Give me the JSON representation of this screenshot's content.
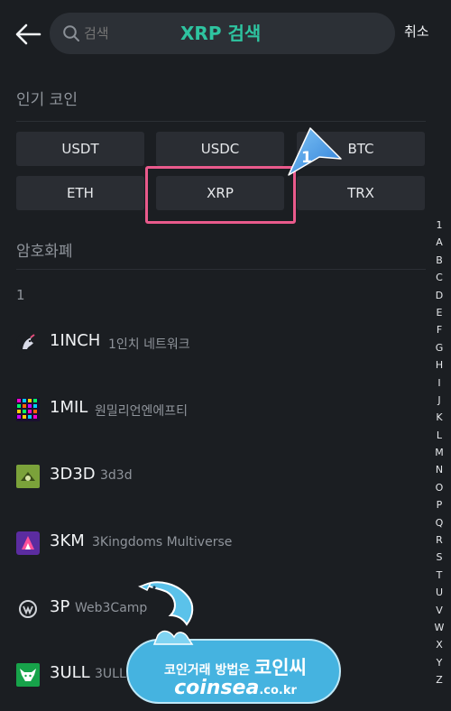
{
  "header": {
    "search_placeholder": "검색",
    "overlay_title": "XRP 검색",
    "cancel_label": "취소"
  },
  "popular": {
    "title": "인기 코인",
    "coins": [
      "USDT",
      "USDC",
      "BTC",
      "ETH",
      "XRP",
      "TRX"
    ]
  },
  "step_marker": "1",
  "crypto": {
    "title": "암호화폐",
    "group_label": "1",
    "rows": [
      {
        "symbol": "1INCH",
        "name": "1인치 네트워크"
      },
      {
        "symbol": "1MIL",
        "name": "원밀리언엔에프티"
      },
      {
        "symbol": "3D3D",
        "name": "3d3d"
      },
      {
        "symbol": "3KM",
        "name": "3Kingdoms Multiverse"
      },
      {
        "symbol": "3P",
        "name": "Web3Camp"
      },
      {
        "symbol": "3ULL",
        "name": "3ULL"
      }
    ]
  },
  "index_letters": [
    "1",
    "A",
    "B",
    "C",
    "D",
    "E",
    "F",
    "G",
    "H",
    "I",
    "J",
    "K",
    "L",
    "M",
    "N",
    "O",
    "P",
    "Q",
    "R",
    "S",
    "T",
    "U",
    "V",
    "W",
    "X",
    "Y",
    "Z"
  ],
  "watermark": {
    "line1": "코인거래 방법은",
    "brand": "코인씨",
    "domain_main": "coinsea",
    "domain_tld": ".co.kr"
  },
  "colors": {
    "background": "#1b1e22",
    "accent_green": "#2ec4a0",
    "highlight_pink": "#ea5a8c",
    "marker_blue": "#3c8fe0"
  }
}
